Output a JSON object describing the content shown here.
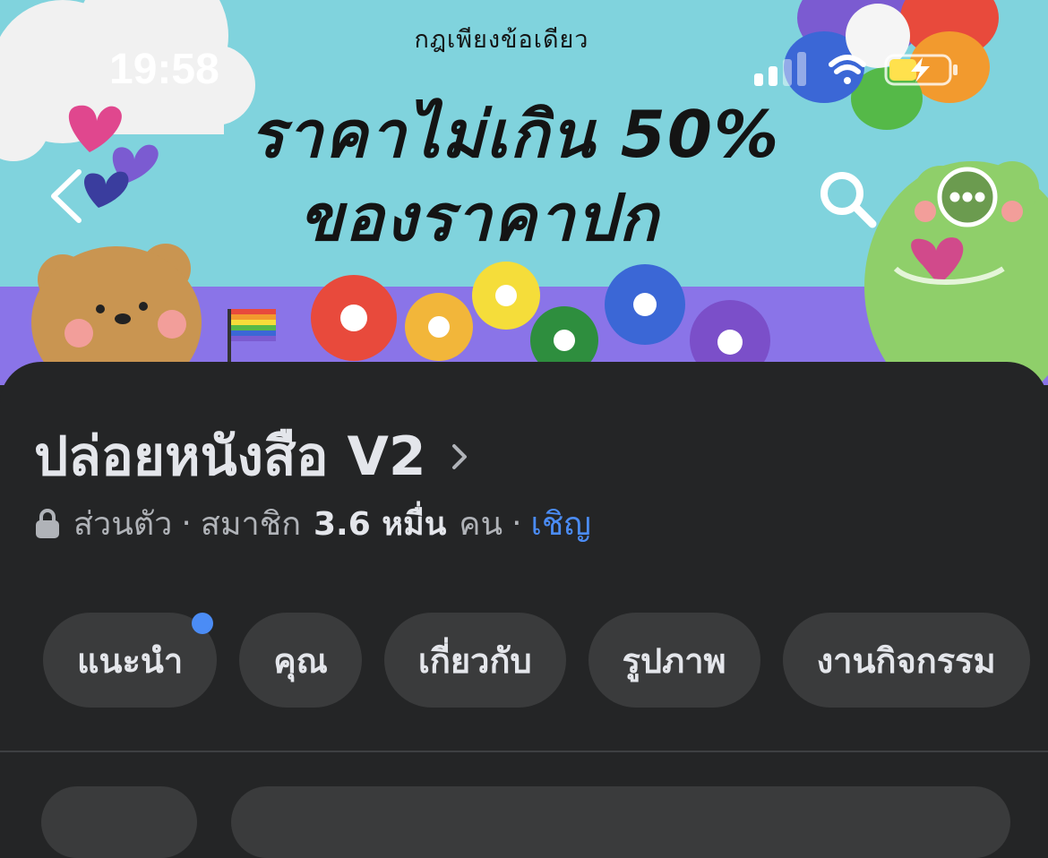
{
  "status_bar": {
    "time": "19:58",
    "icons": [
      "signal-icon",
      "wifi-icon",
      "battery-charging-icon"
    ]
  },
  "cover": {
    "subtitle": "กฎเพียงข้อเดียว",
    "line1": "ราคาไม่เกิน 50%",
    "line2": "ของราคาปก"
  },
  "nav": {
    "back_icon": "chevron-left-icon",
    "search_icon": "search-icon",
    "more_icon": "more-icon"
  },
  "group": {
    "name": "ปล่อยหนังสือ V2",
    "privacy": "ส่วนตัว",
    "separator": "·",
    "members_label": "สมาชิก",
    "members_count": "3.6 หมื่น",
    "members_unit": "คน",
    "invite": "เชิญ"
  },
  "tabs": [
    {
      "label": "แนะนำ",
      "has_dot": true
    },
    {
      "label": "คุณ"
    },
    {
      "label": "เกี่ยวกับ"
    },
    {
      "label": "รูปภาพ"
    },
    {
      "label": "งานกิจกรรม"
    }
  ],
  "colors": {
    "panel_bg": "#242526",
    "pill_bg": "#3a3b3c",
    "accent": "#4b8cf5",
    "text_primary": "#e4e6eb",
    "text_secondary": "#b0b3b8"
  }
}
